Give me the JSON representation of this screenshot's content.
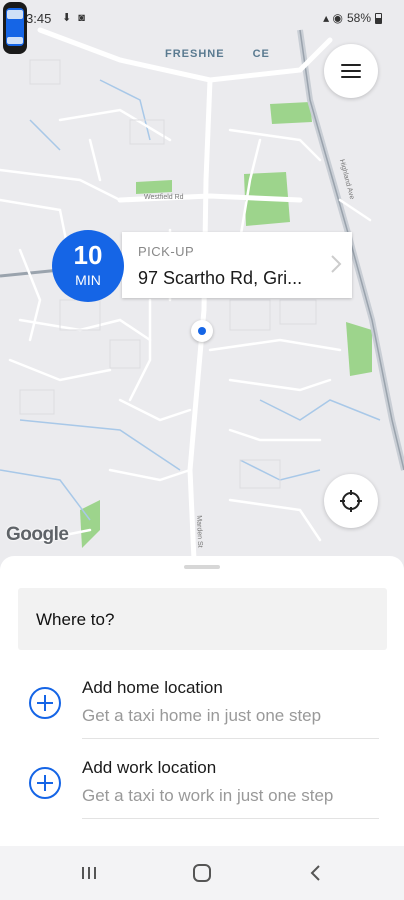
{
  "status_bar": {
    "time": "3:45",
    "battery": "58%"
  },
  "map": {
    "area_label": "FRESHNE",
    "area_label_tail": "CE",
    "attribution": "Google",
    "streets": [
      "Westfield Rd",
      "Marden St",
      "Highland Ave"
    ]
  },
  "pickup": {
    "eta_value": "10",
    "eta_unit": "MIN",
    "label": "PICK-UP",
    "address": "97 Scartho Rd, Gri..."
  },
  "sheet": {
    "search_placeholder": "Where to?",
    "shortcuts": [
      {
        "title": "Add home location",
        "subtitle": "Get a taxi home in just one step"
      },
      {
        "title": "Add work location",
        "subtitle": "Get a taxi to work in just one step"
      }
    ]
  },
  "colors": {
    "accent": "#1565e6",
    "map_bg": "#ebebee",
    "park": "#8fd07a",
    "road": "#ffffff",
    "water": "#a8c8e8"
  },
  "icons": {
    "menu": "hamburger-icon",
    "recenter": "crosshair-icon",
    "add": "plus-circle-icon",
    "chevron": "chevron-right-icon"
  }
}
